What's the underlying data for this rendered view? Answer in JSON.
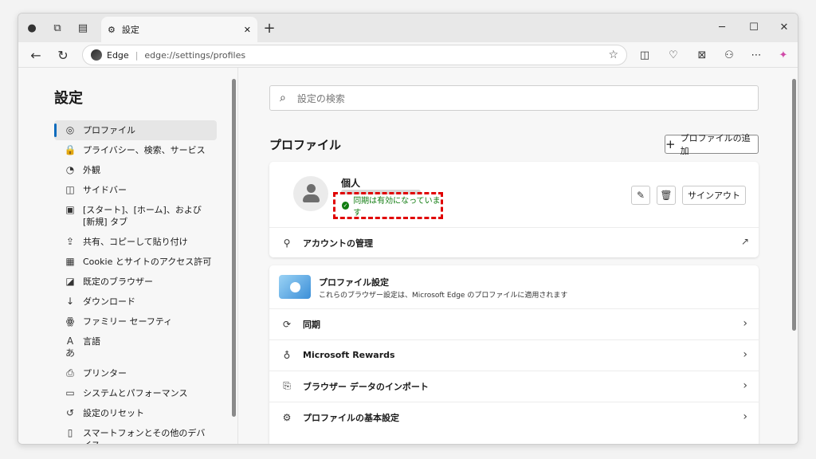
{
  "tab": {
    "title": "設定",
    "icon": "gear-icon"
  },
  "address": {
    "site": "Edge",
    "url": "edge://settings/profiles"
  },
  "window_controls": {
    "minimize": "─",
    "maximize": "☐",
    "close": "✕"
  },
  "sidebar": {
    "title": "設定",
    "items": [
      {
        "label": "プロファイル",
        "icon": "profile-icon",
        "glyph": "◎",
        "active": true
      },
      {
        "label": "プライバシー、検索、サービス",
        "icon": "lock-icon",
        "glyph": "🔒"
      },
      {
        "label": "外観",
        "icon": "appearance-icon",
        "glyph": "◔"
      },
      {
        "label": "サイドバー",
        "icon": "sidebar-icon",
        "glyph": "◫"
      },
      {
        "label": "[スタート]、[ホーム]、および [新規] タブ",
        "icon": "home-tab-icon",
        "glyph": "▣"
      },
      {
        "label": "共有、コピーして貼り付け",
        "icon": "share-icon",
        "glyph": "⇪"
      },
      {
        "label": "Cookie とサイトのアクセス許可",
        "icon": "cookie-icon",
        "glyph": "▦"
      },
      {
        "label": "既定のブラウザー",
        "icon": "default-browser-icon",
        "glyph": "◪"
      },
      {
        "label": "ダウンロード",
        "icon": "download-icon",
        "glyph": "↓"
      },
      {
        "label": "ファミリー セーフティ",
        "icon": "family-icon",
        "glyph": "ꙮ"
      },
      {
        "label": "言語",
        "icon": "language-icon",
        "glyph": "Aあ"
      },
      {
        "label": "プリンター",
        "icon": "printer-icon",
        "glyph": "⎙"
      },
      {
        "label": "システムとパフォーマンス",
        "icon": "system-icon",
        "glyph": "▭"
      },
      {
        "label": "設定のリセット",
        "icon": "reset-icon",
        "glyph": "↺"
      },
      {
        "label": "スマートフォンとその他のデバイス",
        "icon": "phone-icon",
        "glyph": "▯"
      }
    ]
  },
  "main": {
    "search_placeholder": "設定の検索",
    "section_title": "プロファイル",
    "add_profile_label": "プロファイルの追加",
    "profile": {
      "name": "個人",
      "sync_status": "同期は有効になっています",
      "signout_label": "サインアウト"
    },
    "account_row": "アカウントの管理",
    "profile_settings": {
      "title": "プロファイル設定",
      "subtitle": "これらのブラウザー設定は、Microsoft Edge のプロファイルに適用されます"
    },
    "rows": [
      {
        "label": "同期",
        "icon": "sync-icon",
        "glyph": "⟳"
      },
      {
        "label": "Microsoft Rewards",
        "icon": "rewards-icon",
        "glyph": "♁"
      },
      {
        "label": "ブラウザー データのインポート",
        "icon": "import-icon",
        "glyph": "⎘"
      },
      {
        "label": "プロファイルの基本設定",
        "icon": "profile-preferences-icon",
        "glyph": "⚙"
      }
    ]
  }
}
